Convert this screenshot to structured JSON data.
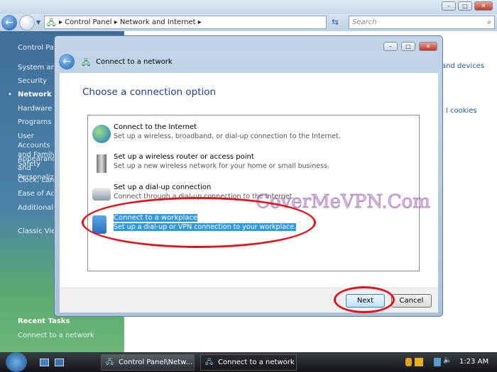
{
  "explorer": {
    "breadcrumb": [
      "Control Panel",
      "Network and Internet"
    ],
    "search_placeholder": "Search",
    "sidebar": {
      "items": [
        "Control Panel Home",
        "System and Maintenance",
        "Security",
        "Network and Internet",
        "Hardware and Sound",
        "Programs",
        "User Accounts and Family Safety",
        "Appearance and Personalization",
        "Clock, Language, and Region",
        "Ease of Access",
        "Additional Options",
        "Classic View"
      ],
      "recent_tasks_heading": "Recent Tasks",
      "recent_tasks": [
        "Connect to a network"
      ]
    },
    "content_links": [
      "and devices",
      "l cookies"
    ]
  },
  "dialog": {
    "title": "Connect to a network",
    "heading": "Choose a connection option",
    "options": [
      {
        "title": "Connect to the Internet",
        "subtitle": "Set up a wireless, broadband, or dial-up connection to the Internet.",
        "icon": "globe-icon",
        "selected": false
      },
      {
        "title": "Set up a wireless router or access point",
        "subtitle": "Set up a new wireless network for your home or small business.",
        "icon": "router-icon",
        "selected": false
      },
      {
        "title": "Set up a dial-up connection",
        "subtitle": "Connect through a dial-up connection to the Internet.",
        "icon": "modem-icon",
        "selected": false
      },
      {
        "title": "Connect to a workplace",
        "subtitle": "Set up a dial-up or VPN connection to your workplace.",
        "icon": "workplace-icon",
        "selected": true
      }
    ],
    "next_label": "Next",
    "cancel_label": "Cancel"
  },
  "taskbar": {
    "tasks": [
      "Control Panel\\Netw...",
      "Connect to a network"
    ],
    "clock": "1:23 AM"
  },
  "watermark": "CoverMeVPN.Com",
  "colors": {
    "selection": "#3399dd",
    "highlight_ring": "#e0141c"
  }
}
